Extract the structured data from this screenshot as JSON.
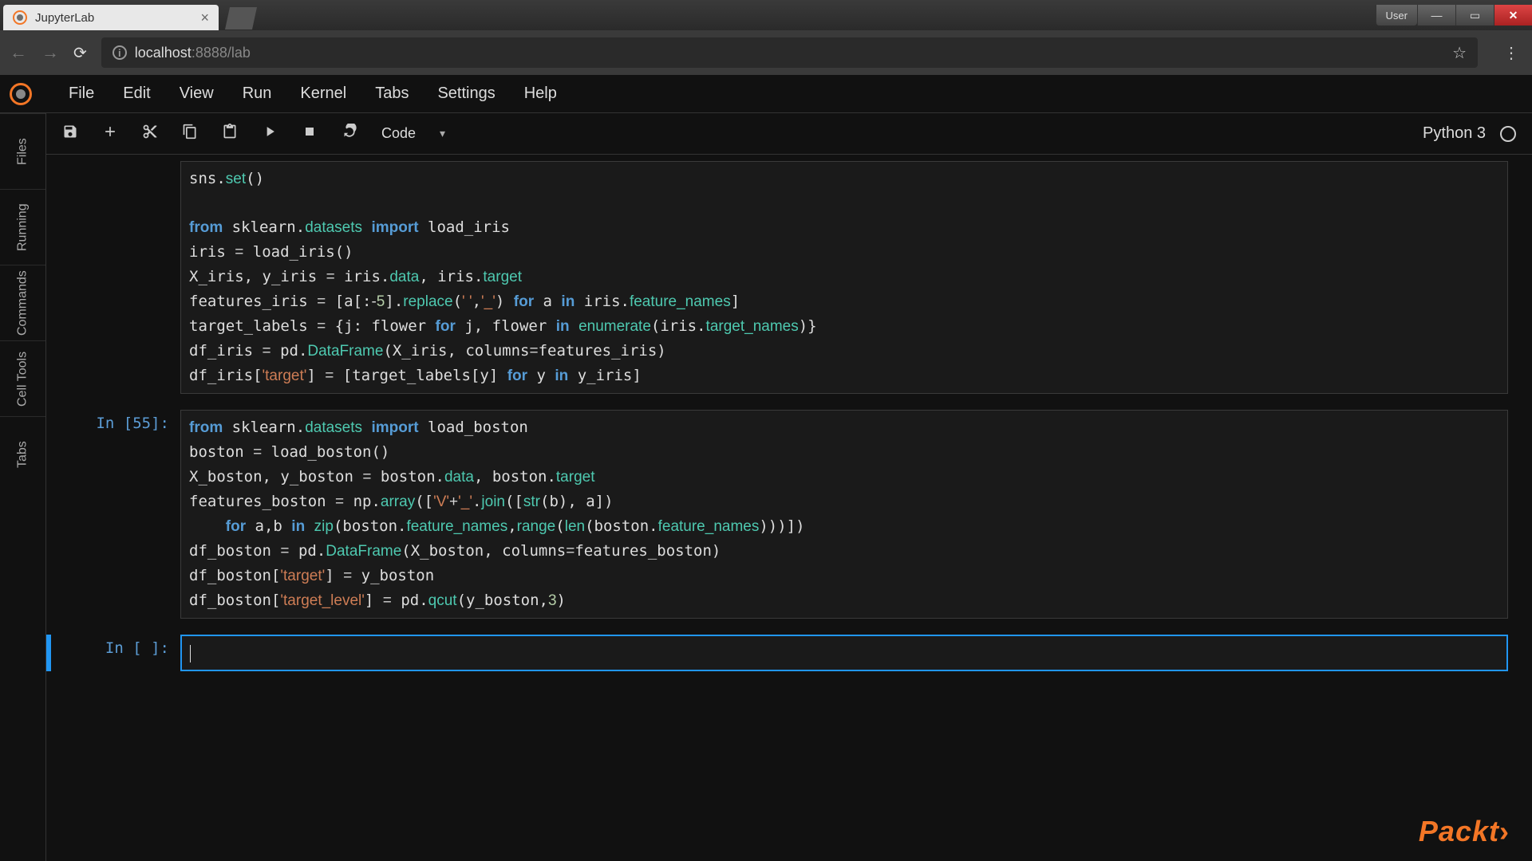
{
  "browser": {
    "tab_title": "JupyterLab",
    "user_label": "User",
    "url_host": "localhost",
    "url_path": ":8888/lab"
  },
  "menu": {
    "items": [
      "File",
      "Edit",
      "View",
      "Run",
      "Kernel",
      "Tabs",
      "Settings",
      "Help"
    ]
  },
  "sidebar": {
    "items": [
      "Files",
      "Running",
      "Commands",
      "Cell Tools",
      "Tabs"
    ]
  },
  "toolbar": {
    "celltype": "Code",
    "kernel": "Python 3"
  },
  "cells": [
    {
      "prompt": "",
      "code_html": "sns.<span class='fn'>set</span>()\n\n<span class='kw'>from</span> sklearn.<span class='mod'>datasets</span> <span class='kw'>import</span> load_iris\niris <span class='op'>=</span> load_iris()\nX_iris, y_iris <span class='op'>=</span> iris.<span class='attr'>data</span>, iris.<span class='attr'>target</span>\nfeatures_iris <span class='op'>=</span> [a[:<span class='op'>-</span><span class='num'>5</span>].<span class='fn'>replace</span>(<span class='str'>' '</span>,<span class='str'>'_'</span>) <span class='kw'>for</span> a <span class='kw'>in</span> iris.<span class='attr'>feature_names</span>]\ntarget_labels <span class='op'>=</span> {j: flower <span class='kw'>for</span> j, flower <span class='kw'>in</span> <span class='builtin'>enumerate</span>(iris.<span class='attr'>target_names</span>)}\ndf_iris <span class='op'>=</span> pd.<span class='fn'>DataFrame</span>(X_iris, columns<span class='op'>=</span>features_iris)\ndf_iris[<span class='str'>'target'</span>] <span class='op'>=</span> [target_labels[y] <span class='kw'>for</span> y <span class='kw'>in</span> y_iris]"
    },
    {
      "prompt": "In [55]:",
      "code_html": "<span class='kw'>from</span> sklearn.<span class='mod'>datasets</span> <span class='kw'>import</span> load_boston\nboston <span class='op'>=</span> load_boston()\nX_boston, y_boston <span class='op'>=</span> boston.<span class='attr'>data</span>, boston.<span class='attr'>target</span>\nfeatures_boston <span class='op'>=</span> np.<span class='fn'>array</span>([<span class='str'>'V'</span><span class='op'>+</span><span class='str'>'_'</span>.<span class='fn'>join</span>([<span class='builtin'>str</span>(b), a])\n    <span class='kw'>for</span> a,b <span class='kw'>in</span> <span class='builtin'>zip</span>(boston.<span class='attr'>feature_names</span>,<span class='builtin'>range</span>(<span class='builtin'>len</span>(boston.<span class='attr'>feature_names</span>)))])\ndf_boston <span class='op'>=</span> pd.<span class='fn'>DataFrame</span>(X_boston, columns<span class='op'>=</span>features_boston)\ndf_boston[<span class='str'>'target'</span>] <span class='op'>=</span> y_boston\ndf_boston[<span class='str'>'target_level'</span>] <span class='op'>=</span> pd.<span class='fn'>qcut</span>(y_boston,<span class='num'>3</span>)"
    },
    {
      "prompt": "In [ ]:",
      "code_html": "<span class='cursor'></span>",
      "active": true
    }
  ],
  "watermark": "Packt"
}
